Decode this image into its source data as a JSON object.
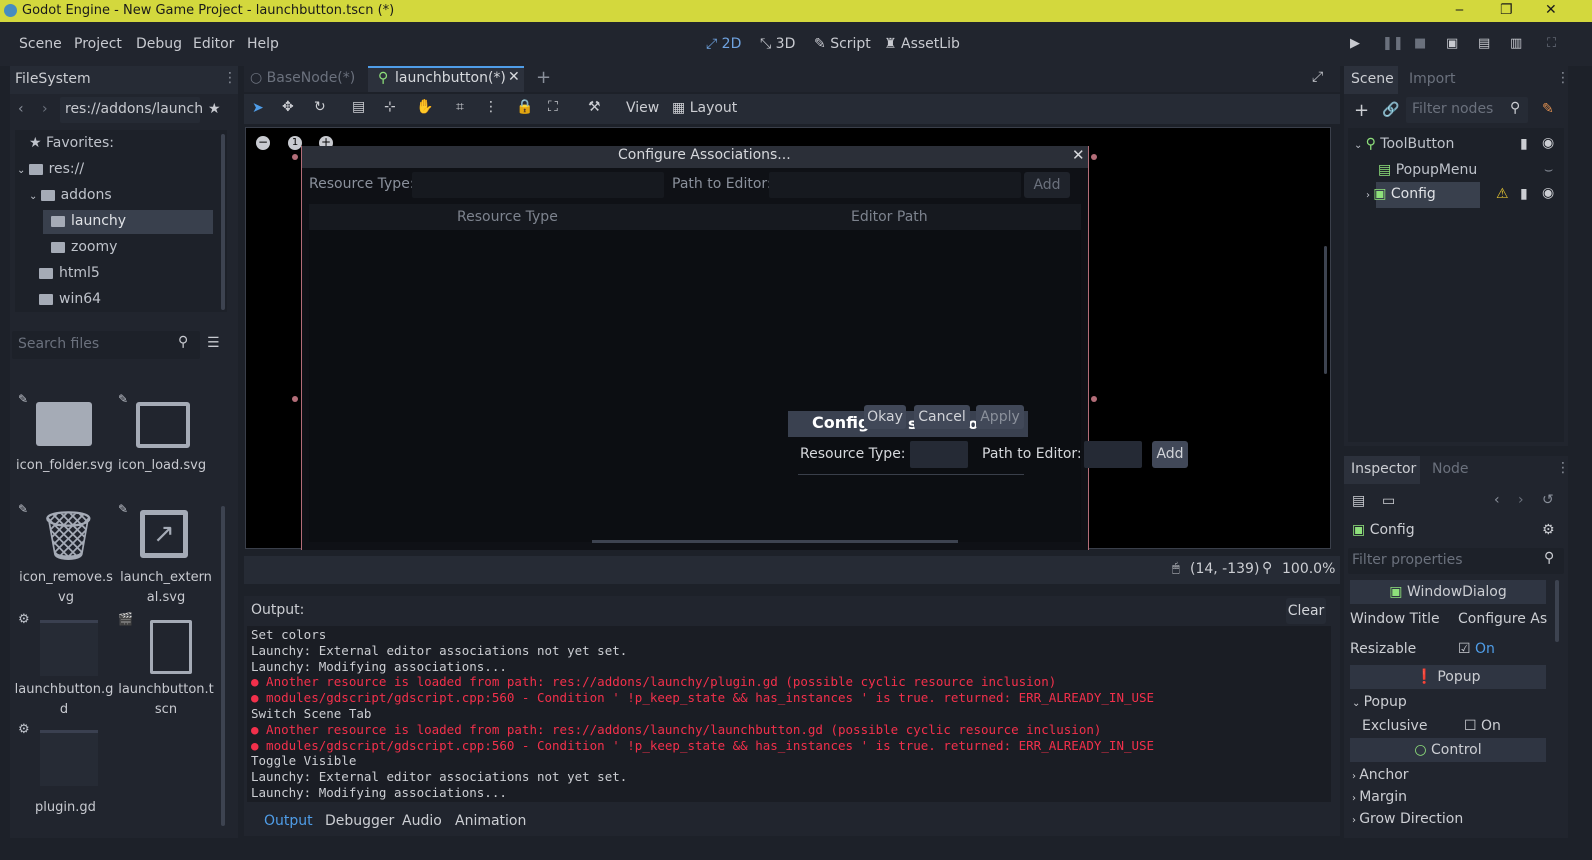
{
  "window": {
    "title": "Godot Engine - New Game Project - launchbutton.tscn (*)",
    "minimize": "‒",
    "maximize": "❐",
    "close": "✕"
  },
  "menu": [
    "Scene",
    "Project",
    "Debug",
    "Editor",
    "Help"
  ],
  "workspaces": [
    "2D",
    "3D",
    "Script",
    "AssetLib"
  ],
  "filesystem": {
    "tab": "FileSystem",
    "path": "res://addons/launch",
    "tree": {
      "favorites": "Favorites:",
      "res": "res://",
      "addons": "addons",
      "launchy": "launchy",
      "zoomy": "zoomy",
      "html5": "html5",
      "win64": "win64"
    },
    "search_placeholder": "Search files",
    "files": [
      {
        "name": "icon_folder.svg"
      },
      {
        "name": "icon_load.svg"
      },
      {
        "name": "icon_remove.s\nvg"
      },
      {
        "name": "launch_extern\nal.svg"
      },
      {
        "name": "launchbutton.g\nd"
      },
      {
        "name": "launchbutton.t\nscn"
      },
      {
        "name": "plugin.gd"
      }
    ]
  },
  "scene_tabs": {
    "tab1": "BaseNode(*)",
    "tab2": "launchbutton(*)",
    "add": "+"
  },
  "toolbar": {
    "view": "View",
    "layout": "Layout"
  },
  "dialog": {
    "title": "Configure Associations...",
    "resource_type_label": "Resource Type:",
    "path_label": "Path to Editor:",
    "add": "Add",
    "col_resource": "Resource Type",
    "col_path": "Editor Path",
    "close": "✕"
  },
  "preview": {
    "title_partial": "Config",
    "title_partial2": "s",
    "title_partial3": "o",
    "okay": "Okay",
    "cancel": "Cancel",
    "apply": "Apply",
    "resource_type_label": "Resource Type:",
    "path_label": "Path to Editor:",
    "add": "Add"
  },
  "status": {
    "coords": "(14, -139)",
    "zoom": "100.0%"
  },
  "output": {
    "label": "Output:",
    "clear": "Clear",
    "lines": [
      {
        "text": "Set colors",
        "err": false
      },
      {
        "text": "Launchy: External editor associations not yet set.",
        "err": false
      },
      {
        "text": "Launchy: Modifying associations...",
        "err": false
      },
      {
        "text": "● Another resource is loaded from path: res://addons/launchy/plugin.gd (possible cyclic resource inclusion)",
        "err": true
      },
      {
        "text": "● modules/gdscript/gdscript.cpp:560 - Condition ' !p_keep_state && has_instances ' is true. returned: ERR_ALREADY_IN_USE",
        "err": true
      },
      {
        "text": "Switch Scene Tab",
        "err": false
      },
      {
        "text": "● Another resource is loaded from path: res://addons/launchy/launchbutton.gd (possible cyclic resource inclusion)",
        "err": true
      },
      {
        "text": "● modules/gdscript/gdscript.cpp:560 - Condition ' !p_keep_state && has_instances ' is true. returned: ERR_ALREADY_IN_USE",
        "err": true
      },
      {
        "text": "Toggle Visible",
        "err": false
      },
      {
        "text": "Launchy: External editor associations not yet set.",
        "err": false
      },
      {
        "text": "Launchy: Modifying associations...",
        "err": false
      }
    ]
  },
  "bottom_tabs": [
    "Output",
    "Debugger",
    "Audio",
    "Animation"
  ],
  "scene_dock": {
    "tab": "Scene",
    "import_tab": "Import",
    "filter_placeholder": "Filter nodes",
    "nodes": {
      "root": "ToolButton",
      "child1": "PopupMenu",
      "child2": "Config"
    }
  },
  "inspector": {
    "tab": "Inspector",
    "node_tab": "Node",
    "object": "Config",
    "filter_placeholder": "Filter properties",
    "section_window": "WindowDialog",
    "window_title_label": "Window Title",
    "window_title_value": "Configure As",
    "resizable_label": "Resizable",
    "resizable_value": "On",
    "section_popup": "Popup",
    "popup_group": "Popup",
    "exclusive_label": "Exclusive",
    "exclusive_value": "On",
    "section_control": "Control",
    "anchor": "Anchor",
    "margin": "Margin",
    "grow": "Grow Direction"
  },
  "colors": {
    "accent": "#4f9de8",
    "error": "#f2304b",
    "warning": "#e0c030",
    "titlebar": "#d3d83d"
  }
}
